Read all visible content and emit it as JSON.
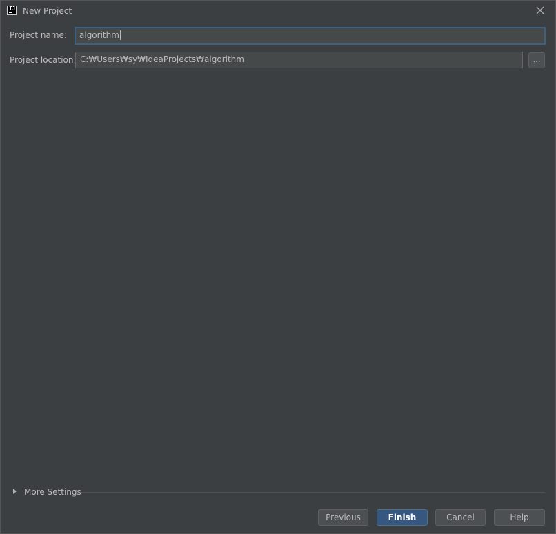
{
  "window": {
    "title": "New Project",
    "icon": "intellij-idea-icon",
    "icon_text": "IJ",
    "close_icon": "close-icon"
  },
  "form": {
    "project_name_label": "Project name:",
    "project_name_value": "algorithm",
    "project_location_label": "Project location:",
    "project_location_value": "C:₩Users₩sy₩IdeaProjects₩algorithm",
    "browse_label": "..."
  },
  "more_settings": {
    "label": "More Settings",
    "expanded": false
  },
  "buttons": {
    "previous": "Previous",
    "finish": "Finish",
    "cancel": "Cancel",
    "help": "Help"
  },
  "colors": {
    "background": "#3c3f41",
    "field_background": "#45494a",
    "focus_border": "#3d6185",
    "default_button": "#365880",
    "text": "#bbbbbb"
  }
}
